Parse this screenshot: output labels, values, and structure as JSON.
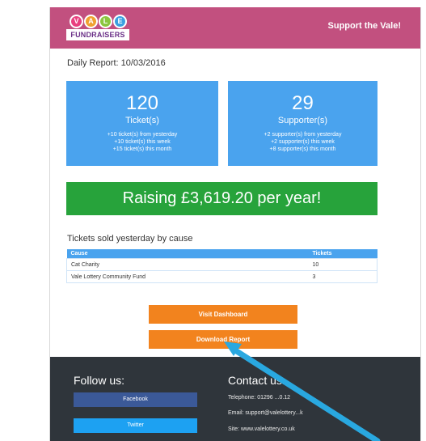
{
  "header": {
    "logo_letters": [
      "V",
      "A",
      "L",
      "E"
    ],
    "logo_colors": [
      "#e9407f",
      "#f0a030",
      "#8cc63f",
      "#3aa0e0"
    ],
    "logo_text": "FUNDRAISERS",
    "support_link": "Support the Vale!",
    "background_color": "#c2507f"
  },
  "report": {
    "date_label": "Daily Report: 10/03/2016"
  },
  "stats": {
    "tickets": {
      "number": "120",
      "label": "Ticket(s)",
      "lines": [
        "+10 ticket(s) from yesterday",
        "+10 ticket(s) this week",
        "+15 ticket(s) this month"
      ]
    },
    "supporters": {
      "number": "29",
      "label": "Supporter(s)",
      "lines": [
        "+2 supporter(s) from yesterday",
        "+2 supporter(s) this week",
        "+8 supporter(s) this month"
      ]
    }
  },
  "raising": {
    "text": "Raising £3,619.20 per year!",
    "color": "#27a33b"
  },
  "causes": {
    "heading": "Tickets sold yesterday by cause",
    "columns": [
      "Cause",
      "Tickets"
    ],
    "rows": [
      [
        "Cat Charity",
        "10"
      ],
      [
        "Vale Lottery Community Fund",
        "3"
      ]
    ]
  },
  "buttons": {
    "dashboard": "Visit Dashboard",
    "download": "Download Report",
    "color": "#f2831e"
  },
  "footer": {
    "follow_title": "Follow us:",
    "facebook_label": "Facebook",
    "twitter_label": "Twitter",
    "contact_title": "Contact us:",
    "telephone": "Telephone: 01296 ...0.12",
    "email": "Email: support@valelottery...k",
    "site": "Site: www.valelottery.co.uk",
    "background_color": "#2f353b"
  },
  "annotation": {
    "icon": "arrow-pointer-icon",
    "color": "#29a8e0"
  }
}
